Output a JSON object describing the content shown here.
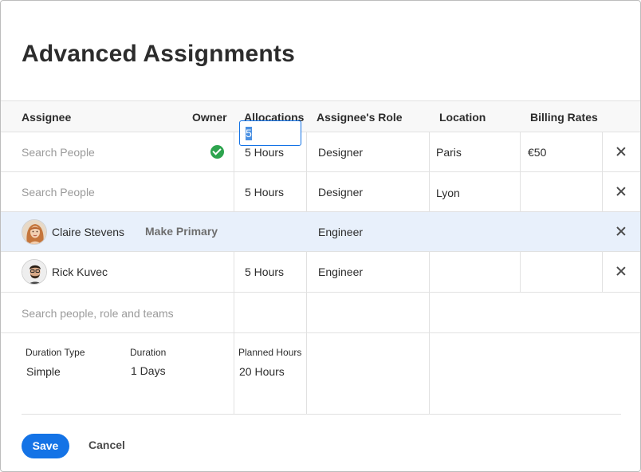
{
  "dialog": {
    "title": "Advanced Assignments"
  },
  "table": {
    "headers": {
      "assignee": "Assignee",
      "owner": "Owner",
      "allocations": "Allocations",
      "role": "Assignee's Role",
      "location": "Location",
      "billing": "Billing Rates"
    },
    "rows": [
      {
        "assignee_placeholder": "Search People",
        "owner": true,
        "allocation": "5 Hours",
        "role": "Designer",
        "location": "Paris",
        "billing": "€50"
      },
      {
        "assignee_placeholder": "Search People",
        "owner": false,
        "allocation": "5 Hours",
        "role": "Designer",
        "location": "Lyon",
        "billing": ""
      },
      {
        "assignee_name": "Claire Stevens",
        "action": "Make Primary",
        "allocation_input": "5",
        "role": "Engineer",
        "location": "",
        "billing": "",
        "selected": true
      },
      {
        "assignee_name": "Rick Kuvec",
        "allocation": "5 Hours",
        "role": "Engineer",
        "location": "",
        "billing": ""
      }
    ],
    "add_placeholder": "Search people, role and teams"
  },
  "duration": {
    "type_label": "Duration Type",
    "type_value": "Simple",
    "duration_label": "Duration",
    "duration_value": "1 Days",
    "planned_label": "Planned Hours",
    "planned_value": "20 Hours"
  },
  "footer": {
    "save_label": "Save",
    "cancel_label": "Cancel"
  },
  "colors": {
    "accent": "#1473e6",
    "owner_check": "#2da44e",
    "selected_row": "#e8f0fb"
  },
  "icons": {
    "owner": "check-circle-icon",
    "remove": "close-icon"
  }
}
